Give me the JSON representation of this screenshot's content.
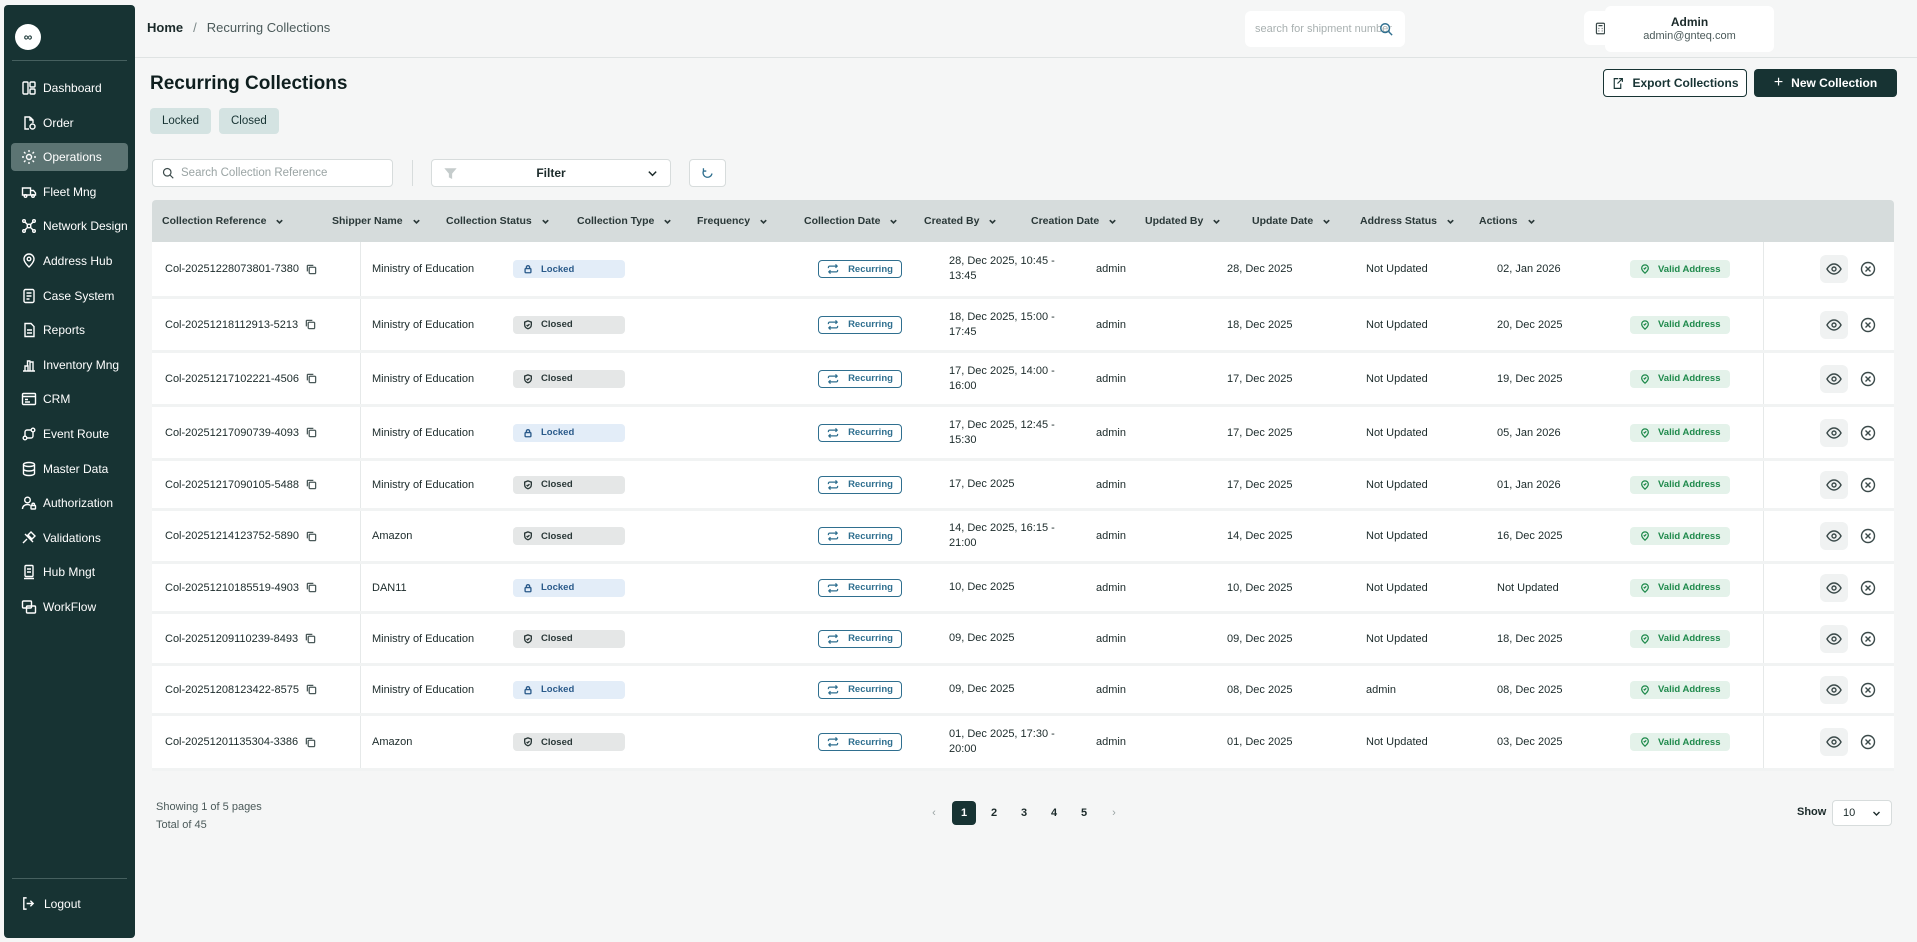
{
  "brand": {
    "logo_text": "∞"
  },
  "sidebar": {
    "items": [
      {
        "label": "Dashboard",
        "icon": "dashboard-icon"
      },
      {
        "label": "Order",
        "icon": "order-icon"
      },
      {
        "label": "Operations",
        "icon": "operations-icon",
        "active": true
      },
      {
        "label": "Fleet Mng",
        "icon": "truck-icon"
      },
      {
        "label": "Network Design",
        "icon": "network-icon"
      },
      {
        "label": "Address Hub",
        "icon": "location-icon"
      },
      {
        "label": "Case System",
        "icon": "case-icon"
      },
      {
        "label": "Reports",
        "icon": "report-icon"
      },
      {
        "label": "Inventory Mng",
        "icon": "inventory-icon"
      },
      {
        "label": "CRM",
        "icon": "crm-icon"
      },
      {
        "label": "Event Route",
        "icon": "route-icon"
      },
      {
        "label": "Master Data",
        "icon": "database-icon"
      },
      {
        "label": "Authorization",
        "icon": "user-lock-icon"
      },
      {
        "label": "Validations",
        "icon": "validation-icon"
      },
      {
        "label": "Hub Mngt",
        "icon": "hub-icon"
      },
      {
        "label": "WorkFlow",
        "icon": "workflow-icon"
      }
    ],
    "logout_label": "Logout"
  },
  "header": {
    "breadcrumb": {
      "home": "Home",
      "separator": "/",
      "current": "Recurring Collections"
    },
    "search_placeholder": "search for shipment number",
    "user": {
      "name": "Admin",
      "email": "admin@gnteq.com"
    }
  },
  "page": {
    "title": "Recurring Collections",
    "chips": [
      "Locked",
      "Closed"
    ],
    "export_label": "Export Collections",
    "new_label": "New Collection",
    "search_placeholder": "Search Collection Reference",
    "filter_label": "Filter"
  },
  "table": {
    "columns": [
      "Collection Reference",
      "Shipper Name",
      "Collection Status",
      "Collection Type",
      "Frequency",
      "Collection Date",
      "Created By",
      "Creation Date",
      "Updated By",
      "Update Date",
      "Address Status",
      "Actions"
    ],
    "rows": [
      {
        "ref": "Col-20251228073801-7380",
        "shipper": "Ministry of Education",
        "status": "Locked",
        "type": "",
        "frequency": "Recurring",
        "date": "28, Dec 2025, 10:45 - 13:45",
        "created_by": "admin",
        "creation_date": "28, Dec 2025",
        "updated_by": "Not Updated",
        "update_date": "02, Jan 2026",
        "address": "Valid Address"
      },
      {
        "ref": "Col-20251218112913-5213",
        "shipper": "Ministry of Education",
        "status": "Closed",
        "type": "",
        "frequency": "Recurring",
        "date": "18, Dec 2025, 15:00 - 17:45",
        "created_by": "admin",
        "creation_date": "18, Dec 2025",
        "updated_by": "Not Updated",
        "update_date": "20, Dec 2025",
        "address": "Valid Address"
      },
      {
        "ref": "Col-20251217102221-4506",
        "shipper": "Ministry of Education",
        "status": "Closed",
        "type": "",
        "frequency": "Recurring",
        "date": "17, Dec 2025, 14:00 - 16:00",
        "created_by": "admin",
        "creation_date": "17, Dec 2025",
        "updated_by": "Not Updated",
        "update_date": "19, Dec 2025",
        "address": "Valid Address"
      },
      {
        "ref": "Col-20251217090739-4093",
        "shipper": "Ministry of Education",
        "status": "Locked",
        "type": "",
        "frequency": "Recurring",
        "date": "17, Dec 2025, 12:45 - 15:30",
        "created_by": "admin",
        "creation_date": "17, Dec 2025",
        "updated_by": "Not Updated",
        "update_date": "05, Jan 2026",
        "address": "Valid Address"
      },
      {
        "ref": "Col-20251217090105-5488",
        "shipper": "Ministry of Education",
        "status": "Closed",
        "type": "",
        "frequency": "Recurring",
        "date": "17, Dec 2025",
        "created_by": "admin",
        "creation_date": "17, Dec 2025",
        "updated_by": "Not Updated",
        "update_date": "01, Jan 2026",
        "address": "Valid Address"
      },
      {
        "ref": "Col-20251214123752-5890",
        "shipper": "Amazon",
        "status": "Closed",
        "type": "",
        "frequency": "Recurring",
        "date": "14, Dec 2025, 16:15 - 21:00",
        "created_by": "admin",
        "creation_date": "14, Dec 2025",
        "updated_by": "Not Updated",
        "update_date": "16, Dec 2025",
        "address": "Valid Address"
      },
      {
        "ref": "Col-20251210185519-4903",
        "shipper": "DAN11",
        "status": "Locked",
        "type": "",
        "frequency": "Recurring",
        "date": "10, Dec 2025",
        "created_by": "admin",
        "creation_date": "10, Dec 2025",
        "updated_by": "Not Updated",
        "update_date": "Not Updated",
        "address": "Valid Address"
      },
      {
        "ref": "Col-20251209110239-8493",
        "shipper": "Ministry of Education",
        "status": "Closed",
        "type": "",
        "frequency": "Recurring",
        "date": "09, Dec 2025",
        "created_by": "admin",
        "creation_date": "09, Dec 2025",
        "updated_by": "Not Updated",
        "update_date": "18, Dec 2025",
        "address": "Valid Address"
      },
      {
        "ref": "Col-20251208123422-8575",
        "shipper": "Ministry of Education",
        "status": "Locked",
        "type": "",
        "frequency": "Recurring",
        "date": "09, Dec 2025",
        "created_by": "admin",
        "creation_date": "08, Dec 2025",
        "updated_by": "admin",
        "update_date": "08, Dec 2025",
        "address": "Valid Address"
      },
      {
        "ref": "Col-20251201135304-3386",
        "shipper": "Amazon",
        "status": "Closed",
        "type": "",
        "frequency": "Recurring",
        "date": "01, Dec 2025, 17:30 - 20:00",
        "created_by": "admin",
        "creation_date": "01, Dec 2025",
        "updated_by": "Not Updated",
        "update_date": "03, Dec 2025",
        "address": "Valid Address"
      }
    ]
  },
  "footer": {
    "showing": "Showing 1 of 5 pages",
    "total": "Total of 45",
    "pages": [
      "1",
      "2",
      "3",
      "4",
      "5"
    ],
    "current_page": "1",
    "prev": "‹",
    "next": "›",
    "show_label": "Show",
    "page_size": "10"
  },
  "colors": {
    "sidebar_bg": "#173333",
    "primary": "#173333",
    "locked_bg": "#e3edf8",
    "closed_bg": "#e5e7e7",
    "valid_green": "#1f8a4c",
    "frequency_blue": "#2f6f8f"
  }
}
